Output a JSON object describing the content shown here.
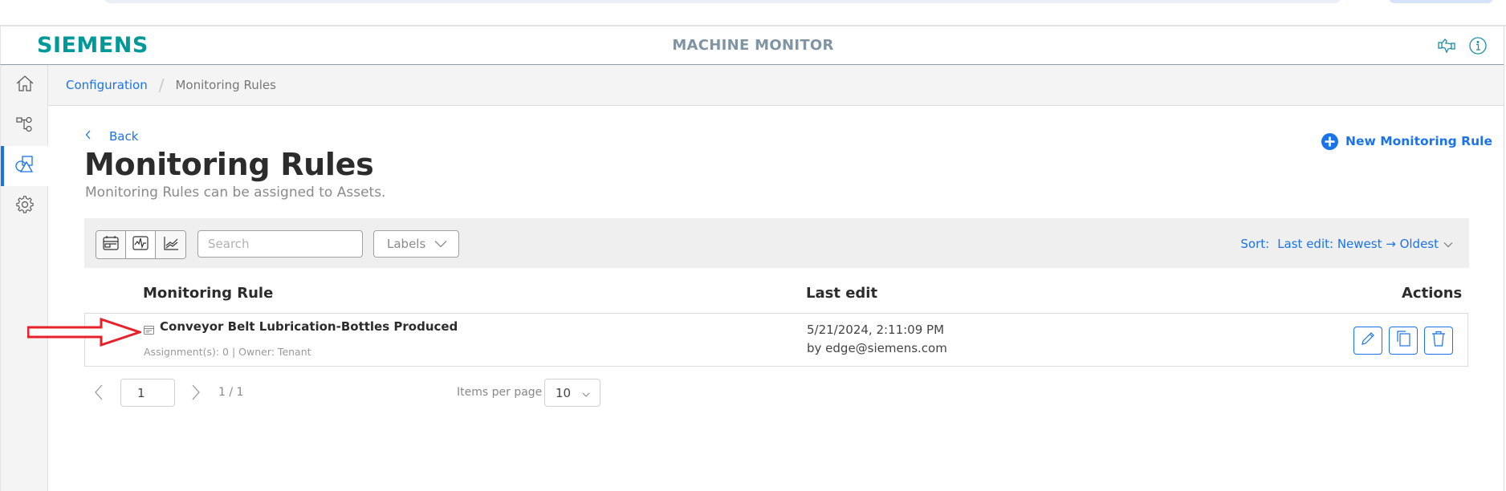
{
  "header": {
    "logo": "SIEMENS",
    "app_title": "MACHINE MONITOR",
    "icons": [
      "handshake-icon",
      "info-icon"
    ]
  },
  "sidebar": {
    "items": [
      {
        "name": "home",
        "icon": "home-icon",
        "active": false
      },
      {
        "name": "asset-tree",
        "icon": "hierarchy-icon",
        "active": false
      },
      {
        "name": "monitoring-rules",
        "icon": "rules-shapes-icon",
        "active": true
      },
      {
        "name": "settings",
        "icon": "gear-icon",
        "active": false
      }
    ]
  },
  "breadcrumb": {
    "items": [
      "Configuration",
      "Monitoring Rules"
    ],
    "separator": "/"
  },
  "page": {
    "back_label": "Back",
    "title": "Monitoring Rules",
    "subtitle": "Monitoring Rules can be assigned to Assets.",
    "new_button_label": "New Monitoring Rule"
  },
  "toolbar": {
    "view_buttons": [
      "card-view-icon",
      "signal-view-icon",
      "chart-view-icon"
    ],
    "search_placeholder": "Search",
    "search_value": "",
    "labels_label": "Labels",
    "sort_label": "Sort:",
    "sort_value": "Last edit: Newest → Oldest"
  },
  "table": {
    "columns": [
      "Monitoring Rule",
      "Last edit",
      "Actions"
    ],
    "rows": [
      {
        "name": "Conveyor Belt Lubrication-Bottles Produced",
        "meta": "Assignment(s): 0 | Owner: Tenant",
        "last_edit_date": "5/21/2024, 2:11:09 PM",
        "last_edit_by": "by edge@siemens.com",
        "actions": [
          "edit",
          "duplicate",
          "delete"
        ]
      }
    ]
  },
  "pagination": {
    "current_page": "1",
    "page_count": "1 / 1",
    "items_per_page_label": "Items per page",
    "items_per_page": "10"
  },
  "colors": {
    "brand": "#009999",
    "accent": "#1a73e8",
    "annotation_arrow": "#e8202a"
  }
}
